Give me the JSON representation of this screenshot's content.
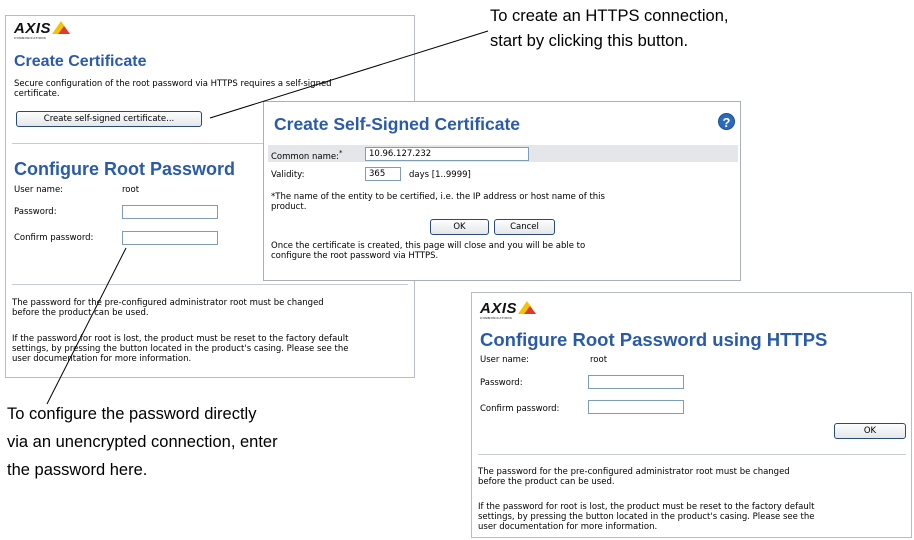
{
  "callouts": {
    "top_right_line1": "To create an HTTPS connection,",
    "top_right_line2": "start by clicking this button.",
    "bottom_left_line1": "To configure the password directly",
    "bottom_left_line2": "via an unencrypted connection, enter",
    "bottom_left_line3": "the password here."
  },
  "left_panel": {
    "logo_text": "AXIS",
    "logo_sub": "COMMUNICATIONS",
    "create_cert_title": "Create Certificate",
    "create_cert_desc_line1": "Secure configuration of the root password via HTTPS requires a self-signed",
    "create_cert_desc_line2": "certificate.",
    "create_cert_button": "Create self-signed certificate...",
    "config_title": "Configure Root Password",
    "user_name_label": "User name:",
    "user_name_value": "root",
    "password_label": "Password:",
    "confirm_label": "Confirm password:",
    "password_value": "",
    "confirm_value": "",
    "info1_line1": "The password for the pre-configured administrator root must be changed",
    "info1_line2": "before the product can be used.",
    "info2_line1": "If the password for root is lost, the product must be reset to the factory default",
    "info2_line2": "settings, by pressing the button located in the product's casing. Please see the",
    "info2_line3": "user documentation for more information."
  },
  "dialog": {
    "title": "Create Self-Signed Certificate",
    "help_icon": "?",
    "common_name_label": "Common name:",
    "common_name_required": "*",
    "common_name_value": "10.96.127.232",
    "validity_label": "Validity:",
    "validity_value": "365",
    "validity_unit": "days [1..9999]",
    "note_line1": "*The name of the entity to be certified, i.e. the IP address or host name of this",
    "note_line2": "product.",
    "ok_button": "OK",
    "cancel_button": "Cancel",
    "footer_line1": "Once the certificate is created, this page will close and you will be able to",
    "footer_line2": "configure the root password via HTTPS."
  },
  "right_panel": {
    "logo_text": "AXIS",
    "logo_sub": "COMMUNICATIONS",
    "title": "Configure Root Password using HTTPS",
    "user_name_label": "User name:",
    "user_name_value": "root",
    "password_label": "Password:",
    "confirm_label": "Confirm password:",
    "password_value": "",
    "confirm_value": "",
    "ok_button": "OK",
    "info1_line1": "The password for the pre-configured administrator root must be changed",
    "info1_line2": "before the product can be used.",
    "info2_line1": "If the password for root is lost, the product must be reset to the factory default",
    "info2_line2": "settings, by pressing the button located in the product's casing. Please see the",
    "info2_line3": "user documentation for more information."
  },
  "colors": {
    "heading_blue": "#2a5ba8",
    "logo_yellow": "#f5c400",
    "logo_red": "#e03a2f",
    "panel_border": "#b7bcc6"
  }
}
